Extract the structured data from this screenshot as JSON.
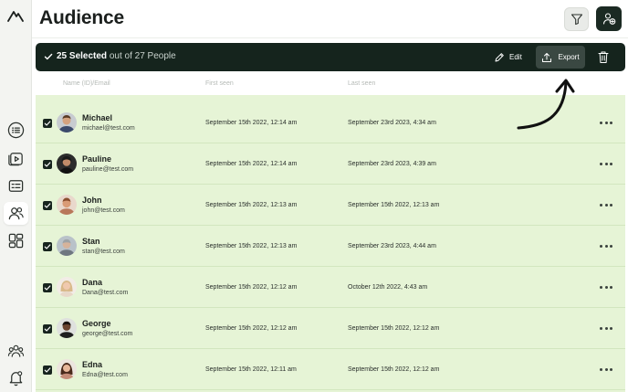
{
  "header": {
    "title": "Audience"
  },
  "selection": {
    "count_label": "25 Selected",
    "total_label": "out of 27 People",
    "edit_label": "Edit",
    "export_label": "Export"
  },
  "columns": {
    "name": "Name (ID)/Email",
    "first_seen": "First seen",
    "last_seen": "Last seen"
  },
  "colors": {
    "accent_dark": "#15241d",
    "row_selected": "#e6f4d6"
  },
  "icons": {
    "logo": "mountain-logo-icon",
    "sidebar": [
      "list-icon",
      "play-icon",
      "card-icon",
      "audience-icon",
      "grid-icon",
      "team-icon",
      "bell-icon"
    ],
    "header": [
      "filter-icon",
      "add-audience-icon"
    ]
  },
  "rows": [
    {
      "name": "Michael",
      "email": "michael@test.com",
      "first_seen": "September 15th 2022, 12:14 am",
      "last_seen": "September 23rd 2023, 4:34 am",
      "selected": true
    },
    {
      "name": "Pauline",
      "email": "pauline@test.com",
      "first_seen": "September 15th 2022, 12:14 am",
      "last_seen": "September 23rd 2023, 4:39 am",
      "selected": true
    },
    {
      "name": "John",
      "email": "john@test.com",
      "first_seen": "September 15th 2022, 12:13 am",
      "last_seen": "September 15th 2022, 12:13 am",
      "selected": true
    },
    {
      "name": "Stan",
      "email": "stan@test.com",
      "first_seen": "September 15th 2022, 12:13 am",
      "last_seen": "September 23rd 2023, 4:44 am",
      "selected": true
    },
    {
      "name": "Dana",
      "email": "Dana@test.com",
      "first_seen": "September 15th 2022, 12:12 am",
      "last_seen": "October 12th 2022, 4:43 am",
      "selected": true
    },
    {
      "name": "George",
      "email": "george@test.com",
      "first_seen": "September 15th 2022, 12:12 am",
      "last_seen": "September 15th 2022, 12:12 am",
      "selected": true
    },
    {
      "name": "Edna",
      "email": "Edna@test.com",
      "first_seen": "September 15th 2022, 12:11 am",
      "last_seen": "September 15th 2022, 12:12 am",
      "selected": true
    }
  ]
}
